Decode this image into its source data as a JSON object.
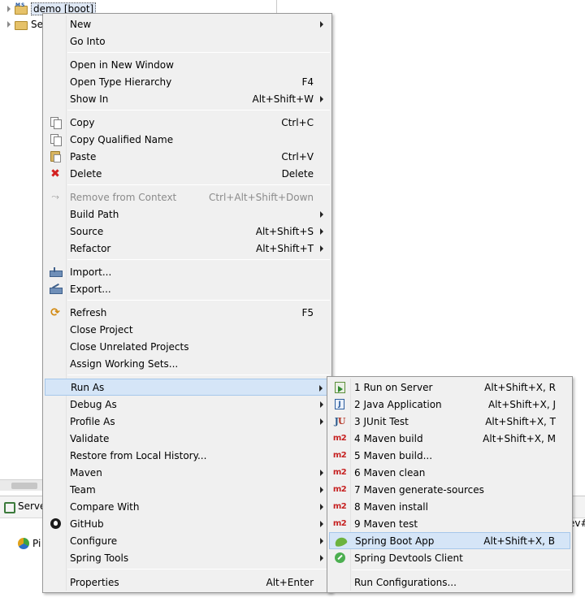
{
  "tree": {
    "items": [
      {
        "label": "demo [boot]",
        "selected": true
      },
      {
        "label": "Se"
      }
    ]
  },
  "bottom": {
    "servers_tab_label": "Server",
    "pivotal_label": "Pi",
    "right_fragment": "ev#"
  },
  "context_menu": {
    "items": [
      {
        "label": "New",
        "submenu": true
      },
      {
        "label": "Go Into"
      },
      {
        "separator": true
      },
      {
        "label": "Open in New Window"
      },
      {
        "label": "Open Type Hierarchy",
        "shortcut": "F4"
      },
      {
        "label": "Show In",
        "shortcut": "Alt+Shift+W",
        "submenu": true
      },
      {
        "separator": true
      },
      {
        "label": "Copy",
        "shortcut": "Ctrl+C",
        "icon": "copy-icon"
      },
      {
        "label": "Copy Qualified Name",
        "icon": "copy-qualified-name-icon"
      },
      {
        "label": "Paste",
        "shortcut": "Ctrl+V",
        "icon": "paste-icon"
      },
      {
        "label": "Delete",
        "shortcut": "Delete",
        "icon": "delete-icon"
      },
      {
        "separator": true
      },
      {
        "label": "Remove from Context",
        "shortcut": "Ctrl+Alt+Shift+Down",
        "icon": "remove-context-icon",
        "disabled": true
      },
      {
        "label": "Build Path",
        "submenu": true
      },
      {
        "label": "Source",
        "shortcut": "Alt+Shift+S",
        "submenu": true
      },
      {
        "label": "Refactor",
        "shortcut": "Alt+Shift+T",
        "submenu": true
      },
      {
        "separator": true
      },
      {
        "label": "Import...",
        "icon": "import-icon"
      },
      {
        "label": "Export...",
        "icon": "export-icon"
      },
      {
        "separator": true
      },
      {
        "label": "Refresh",
        "shortcut": "F5",
        "icon": "refresh-icon"
      },
      {
        "label": "Close Project"
      },
      {
        "label": "Close Unrelated Projects"
      },
      {
        "label": "Assign Working Sets..."
      },
      {
        "separator": true
      },
      {
        "label": "Run As",
        "submenu": true,
        "highlighted": true
      },
      {
        "label": "Debug As",
        "submenu": true
      },
      {
        "label": "Profile As",
        "submenu": true
      },
      {
        "label": "Validate"
      },
      {
        "label": "Restore from Local History..."
      },
      {
        "label": "Maven",
        "submenu": true
      },
      {
        "label": "Team",
        "submenu": true
      },
      {
        "label": "Compare With",
        "submenu": true
      },
      {
        "label": "GitHub",
        "submenu": true,
        "icon": "github-icon"
      },
      {
        "label": "Configure",
        "submenu": true
      },
      {
        "label": "Spring Tools",
        "submenu": true
      },
      {
        "separator": true
      },
      {
        "label": "Properties",
        "shortcut": "Alt+Enter"
      }
    ]
  },
  "run_as_menu": {
    "items": [
      {
        "label": "1 Run on Server",
        "shortcut": "Alt+Shift+X, R",
        "icon": "run-on-server-icon"
      },
      {
        "label": "2 Java Application",
        "shortcut": "Alt+Shift+X, J",
        "icon": "java-application-icon",
        "icon_text": "J"
      },
      {
        "label": "3 JUnit Test",
        "shortcut": "Alt+Shift+X, T",
        "icon": "junit-icon"
      },
      {
        "label": "4 Maven build",
        "shortcut": "Alt+Shift+X, M",
        "icon": "maven-icon"
      },
      {
        "label": "5 Maven build...",
        "icon": "maven-icon"
      },
      {
        "label": "6 Maven clean",
        "icon": "maven-icon"
      },
      {
        "label": "7 Maven generate-sources",
        "icon": "maven-icon"
      },
      {
        "label": "8 Maven install",
        "icon": "maven-icon"
      },
      {
        "label": "9 Maven test",
        "icon": "maven-icon"
      },
      {
        "label": "Spring Boot App",
        "shortcut": "Alt+Shift+X, B",
        "icon": "spring-boot-icon",
        "highlighted": true
      },
      {
        "label": "Spring Devtools Client",
        "icon": "spring-devtools-icon"
      },
      {
        "separator": true
      },
      {
        "label": "Run Configurations..."
      }
    ]
  },
  "icon_text": {
    "maven": "m2",
    "junit_j": "J",
    "junit_u": "U",
    "delete": "✖",
    "remove": "⤳",
    "refresh": "⟳",
    "project_badge": "M S"
  },
  "colors": {
    "menu_bg": "#f0f0f0",
    "highlight": "#d5e5f7",
    "highlight_border": "#a6c7ea",
    "maven_red": "#c62121",
    "spring_green": "#6db33f"
  }
}
